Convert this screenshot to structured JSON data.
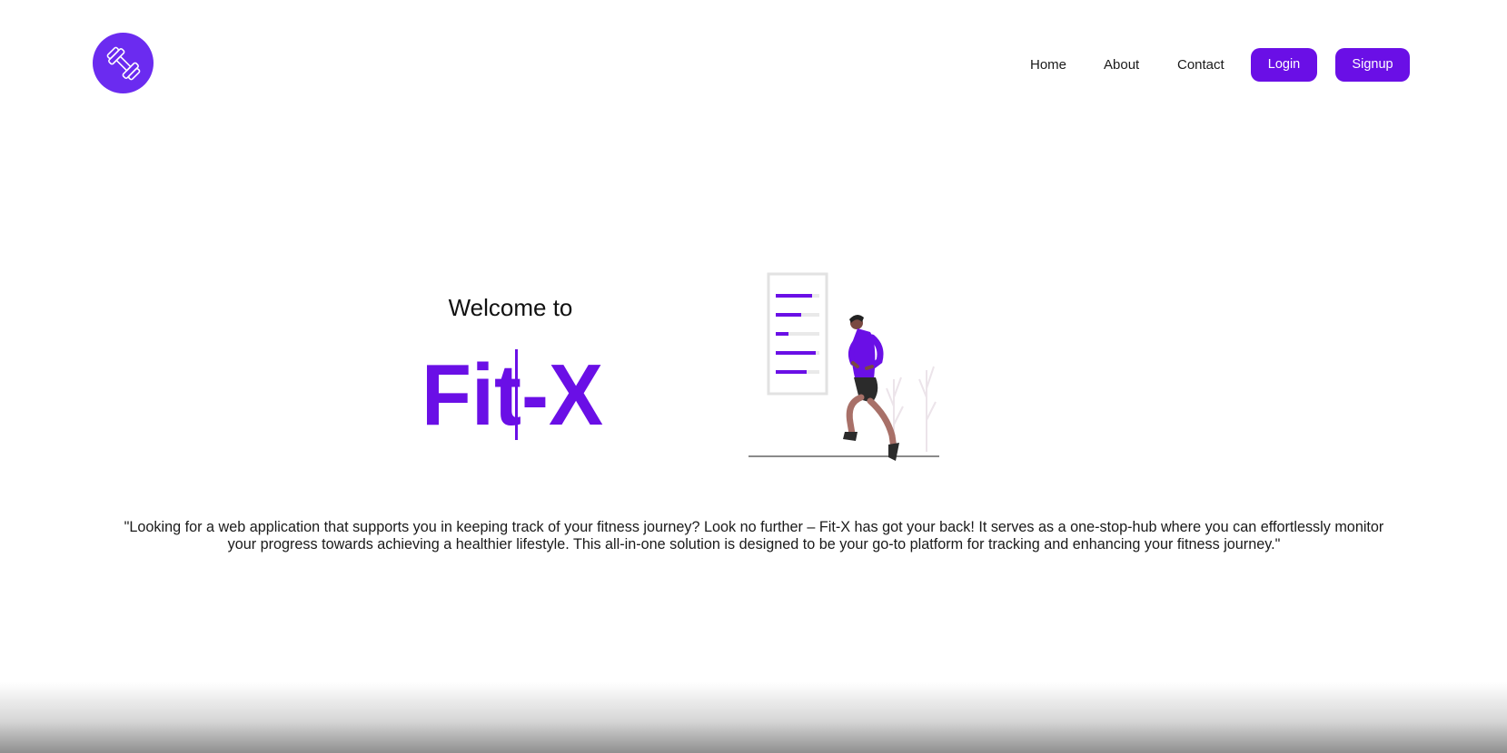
{
  "brand": {
    "logo_icon": "dumbbell-icon",
    "accent_color": "#6a0fe6",
    "wordmark": "Fit-X"
  },
  "nav": {
    "home": "Home",
    "about": "About",
    "contact": "Contact",
    "login": "Login",
    "signup": "Signup"
  },
  "hero": {
    "welcome": "Welcome to",
    "illustration_icon": "runner-with-progress-board-icon",
    "tagline": "\"Looking for a web application that supports you in keeping track of your fitness journey? Look no further – Fit-X has got your back! It serves as a one-stop-hub where you can effortlessly monitor your progress towards achieving a healthier lifestyle. This all-in-one solution is designed to be your go-to platform for tracking and enhancing your fitness journey.\""
  }
}
